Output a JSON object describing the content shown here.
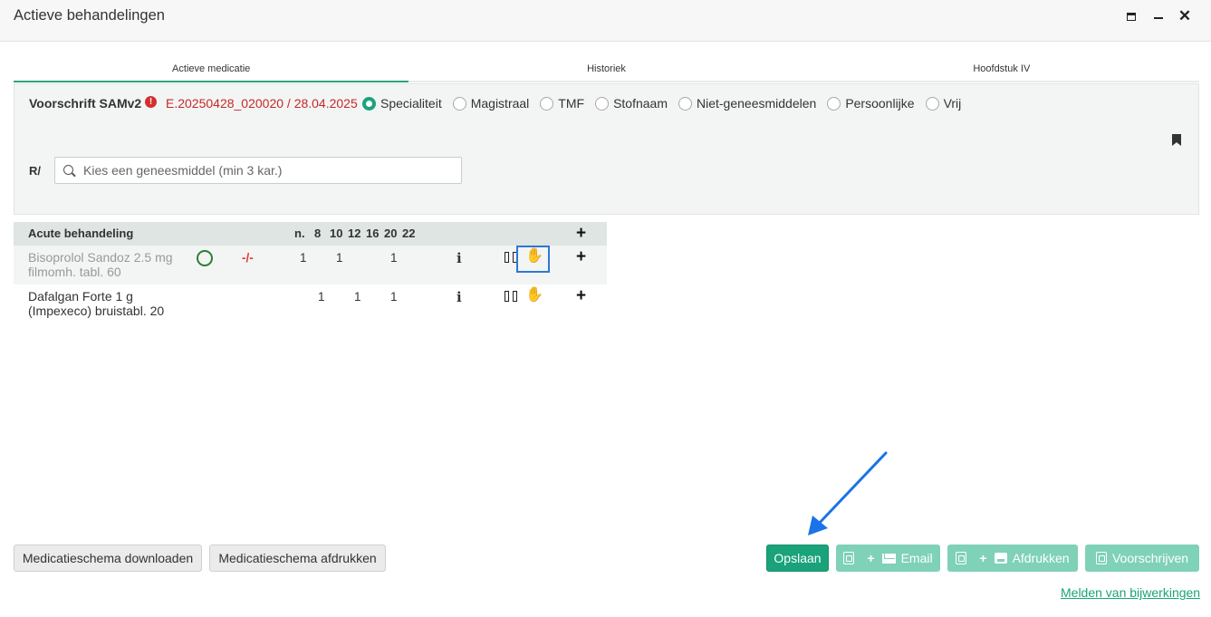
{
  "window": {
    "title": "Actieve behandelingen"
  },
  "tabs": [
    {
      "label": "Actieve medicatie",
      "active": true
    },
    {
      "label": "Historiek",
      "active": false
    },
    {
      "label": "Hoofdstuk IV",
      "active": false
    }
  ],
  "prescription": {
    "label": "Voorschrift SAMv2",
    "id_text": "E.20250428_020020 / 28.04.2025",
    "types": [
      {
        "label": "Specialiteit",
        "checked": true
      },
      {
        "label": "Magistraal",
        "checked": false
      },
      {
        "label": "TMF",
        "checked": false
      },
      {
        "label": "Stofnaam",
        "checked": false
      },
      {
        "label": "Niet-geneesmiddelen",
        "checked": false
      },
      {
        "label": "Persoonlijke",
        "checked": false
      },
      {
        "label": "Vrij",
        "checked": false
      }
    ],
    "rx_prefix": "R/",
    "search_placeholder": "Kies een geneesmiddel (min 3 kar.)",
    "search_value": ""
  },
  "treatment_table": {
    "header": {
      "name": "Acute behandeling",
      "columns": [
        "n.",
        "8",
        "10",
        "12",
        "16",
        "20",
        "22"
      ],
      "add_label": "+"
    },
    "rows": [
      {
        "drug": "Bisoprolol Sandoz 2.5 mg filmomh. tabl. 60",
        "dash": "-/-",
        "values": {
          "n": "1",
          "c10": "1",
          "c20": "1"
        },
        "info": "i",
        "add_label": "+"
      },
      {
        "drug": "Dafalgan Forte 1 g (Impexeco) bruistabl. 20",
        "values": {
          "c8": "1",
          "c12": "1",
          "c20": "1"
        },
        "info": "i",
        "add_label": "+"
      }
    ]
  },
  "buttons": {
    "download_schema": "Medicatieschema downloaden",
    "print_schema": "Medicatieschema afdrukken",
    "save": "Opslaan",
    "email": "Email",
    "print": "Afdrukken",
    "prescribe": "Voorschrijven",
    "plus": "+"
  },
  "links": {
    "report_side_effects": "Melden van bijwerkingen"
  },
  "colors": {
    "accent_green": "#1aa37a",
    "alert_red": "#c62828",
    "highlight_blue": "#2b78d6",
    "annotation_arrow": "#1a73e8"
  },
  "icons": [
    "maximize-icon",
    "minimize-icon",
    "close-icon",
    "alert-icon",
    "bookmark-icon",
    "search-icon",
    "status-circle-icon",
    "info-icon",
    "pause-icon",
    "hand-icon",
    "document-icon",
    "mail-icon",
    "printer-icon",
    "annotation-arrow"
  ]
}
